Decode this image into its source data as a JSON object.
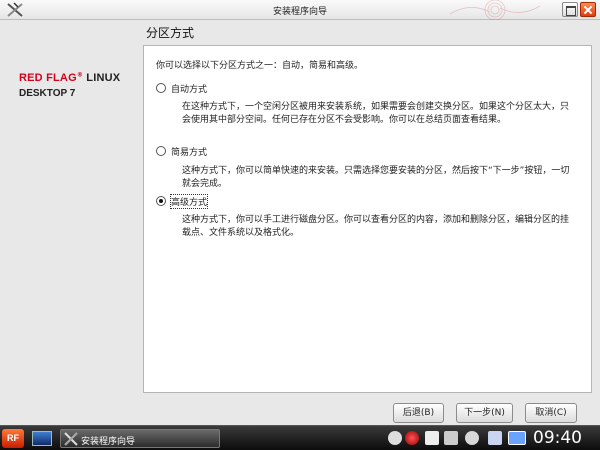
{
  "window": {
    "title": "安装程序向导"
  },
  "brand": {
    "red": "RED FLAG",
    "reg": "®",
    "linux": " LINUX",
    "line2": "DESKTOP 7"
  },
  "page": {
    "title": "分区方式",
    "intro": "你可以选择以下分区方式之一：自动，简易和高级。"
  },
  "options": [
    {
      "label": "自动方式",
      "selected": false,
      "description": "在这种方式下，一个空闲分区被用来安装系统，如果需要会创建交换分区。如果这个分区太大，只会使用其中部分空间。任何已存在分区不会受影响。你可以在总结页面查看结果。"
    },
    {
      "label": "简易方式",
      "selected": false,
      "description": "这种方式下，你可以简单快速的来安装。只需选择您要安装的分区，然后按下“下一步”按钮，一切就会完成。"
    },
    {
      "label": "高级方式",
      "selected": true,
      "description": "这种方式下，你可以手工进行磁盘分区。你可以查看分区的内容，添加和删除分区，编辑分区的挂载点、文件系统以及格式化。"
    }
  ],
  "buttons": {
    "back": "后退(B)",
    "next": "下一步(N)",
    "cancel": "取消(C)"
  },
  "taskbar": {
    "start": "RF",
    "task_label": "安装程序向导",
    "clock": "09:40"
  },
  "colors": {
    "brand_red": "#d6001c",
    "close_button": "#e03c10",
    "taskbar": "#1a1a1a"
  },
  "icons": [
    "redflag-logo-icon",
    "maximize-icon",
    "close-icon",
    "radio-icon",
    "desktop-icon",
    "wizard-icon",
    "tray-icons",
    "speaker-icon",
    "network-icon"
  ]
}
